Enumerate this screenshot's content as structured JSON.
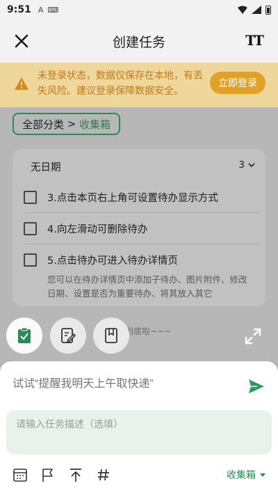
{
  "status_bar": {
    "time": "9:51",
    "notif_a": "A",
    "notif_kb": "⌨"
  },
  "header": {
    "title": "创建任务"
  },
  "warning": {
    "text": "未登录状态，数据仅保存在本地，有丢失风险。建议登录保障数据安全。",
    "button": "立即登录"
  },
  "breadcrumb": {
    "root": "全部分类",
    "separator": " > ",
    "current": "收集箱"
  },
  "list": {
    "section_title": "无日期",
    "count": "3",
    "tasks": [
      {
        "label": "3.点击本页右上角可设置待办显示方式"
      },
      {
        "label": "4.向左滑动可删除待办"
      },
      {
        "label": "5.点击待办可进入待办详情页"
      }
    ],
    "note": "您可以在待办详情页中添加子待办、图片附件、修改日期、设置是否为重要待办、将其放入其它"
  },
  "bottom_text": "到底啦~~~",
  "composer": {
    "title_placeholder": "试试“提醒我明天上午取快递”",
    "desc_placeholder": "请输入任务描述（选填）",
    "folder": "收集箱"
  },
  "colors": {
    "accent": "#2a8a55",
    "warning_bg": "#efd79c",
    "warning_text": "#c07a1a",
    "login_btn": "#e0a126"
  }
}
